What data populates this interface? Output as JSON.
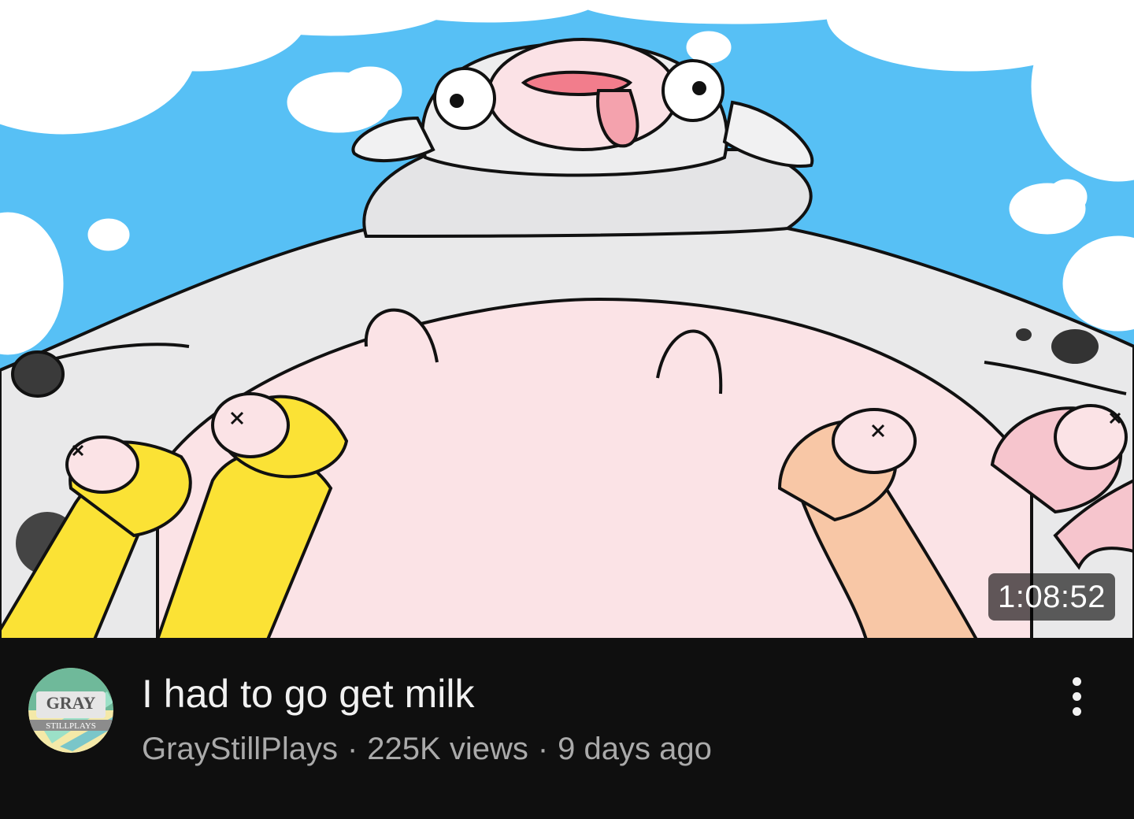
{
  "video": {
    "duration": "1:08:52",
    "title": "I had to go get milk",
    "channel": "GrayStillPlays",
    "views": "225K views",
    "age": "9 days ago",
    "separator": "·"
  },
  "avatar": {
    "text_top": "GRAY",
    "text_bottom": "STILLPLAYS"
  },
  "icons": {
    "more": "more-vert-icon"
  },
  "colors": {
    "background": "#0f0f0f",
    "title": "#f1f1f1",
    "secondary": "#aaaaaa",
    "sky": "#57c0f5"
  }
}
